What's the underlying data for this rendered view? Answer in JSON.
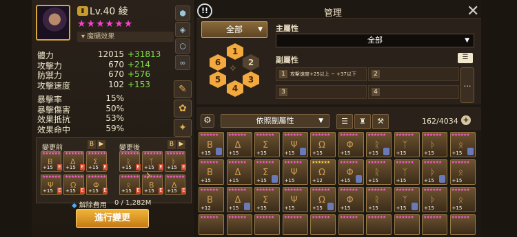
{
  "character": {
    "level": "Lv.40",
    "name": "綾",
    "star_glyphs": "★★★★★★",
    "effect_tab": "魔礪效果"
  },
  "stats": [
    {
      "name": "體力",
      "value": "12015",
      "bonus": "+31813"
    },
    {
      "name": "攻擊力",
      "value": "670",
      "bonus": "+214"
    },
    {
      "name": "防禦力",
      "value": "670",
      "bonus": "+576"
    },
    {
      "name": "攻擊速度",
      "value": "102",
      "bonus": "+153"
    }
  ],
  "stats2": [
    {
      "name": "暴擊率",
      "value": "15%"
    },
    {
      "name": "暴擊傷害",
      "value": "50%"
    },
    {
      "name": "效果抵抗",
      "value": "53%"
    },
    {
      "name": "效果命中",
      "value": "59%"
    }
  ],
  "change_panel": {
    "before_label": "變更前",
    "after_label": "變更後",
    "cost_label": "解除費用",
    "cost_value": "0 / 1,282M",
    "button": "進行變更",
    "rune_level": "+15"
  },
  "manager": {
    "title": "管理",
    "all_dropdown": "全部",
    "main_attr_label": "主屬性",
    "main_attr_value": "全部",
    "sub_attr_label": "副屬性",
    "slots": [
      {
        "n": "1",
        "text": "攻擊速度+25以上 ~ +37以下"
      },
      {
        "n": "2",
        "text": ""
      },
      {
        "n": "3",
        "text": ""
      },
      {
        "n": "4",
        "text": ""
      }
    ],
    "more_label": "…",
    "sort_dropdown": "依照副屬性",
    "count": "162/4034",
    "plus": "+",
    "hex_numbers": [
      "1",
      "2",
      "3",
      "4",
      "5",
      "6"
    ],
    "hex_active": [
      true,
      false,
      true,
      true,
      true,
      true
    ]
  },
  "inventory": {
    "rows": [
      [
        "+15",
        "+15",
        "+15",
        "+15",
        "+15",
        "+15",
        "+15",
        "+15",
        "+15",
        "+15"
      ],
      [
        "+15",
        "+15",
        "+15",
        "+15",
        "+12",
        "+15",
        "+15",
        "+15",
        "+15",
        "+15"
      ],
      [
        "+12",
        "+15",
        "+15",
        "+15",
        "+15",
        "+15",
        "+15",
        "+15",
        "+15",
        "+15"
      ]
    ]
  },
  "ui": {
    "bang": "!!",
    "close": "✕",
    "star_color": "#ff3fd2",
    "bonus_color": "#7fe04a",
    "button_color": "#e89a24"
  }
}
